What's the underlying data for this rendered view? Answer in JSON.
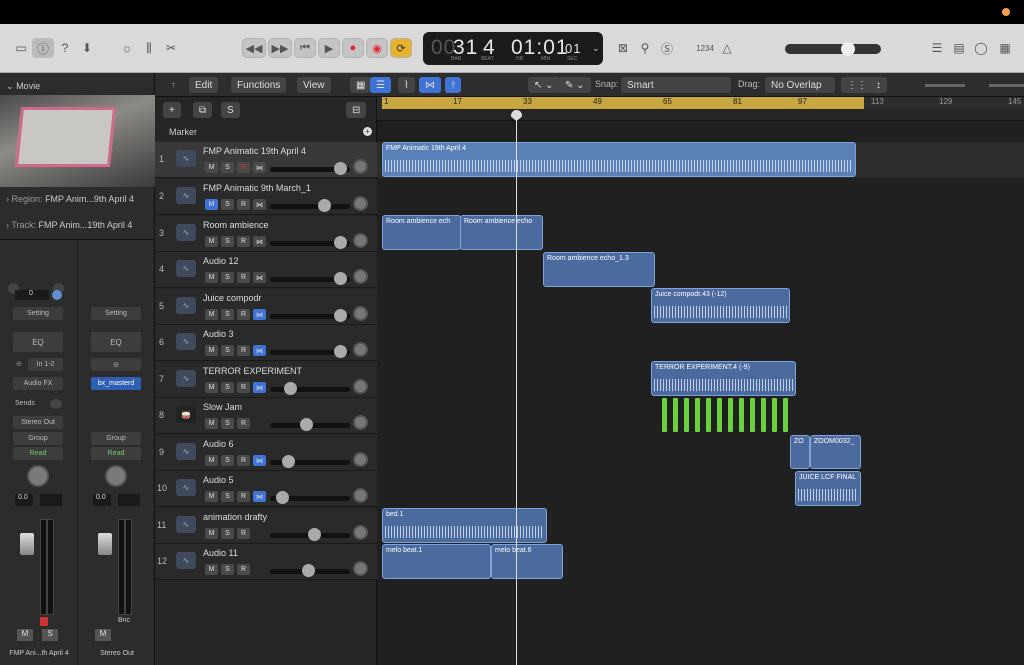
{
  "control_bar": {
    "lcd": {
      "bar": "31",
      "beat": "4",
      "bar_label": "BAR",
      "beat_label": "BEAT",
      "time": "01:01",
      "time_sub": "01",
      "hr_label": "HR",
      "min_label": "MIN",
      "sec_label": "SEC",
      "dim": "00"
    },
    "count_in": "1234"
  },
  "inspector": {
    "section": "Movie",
    "region": "Region:",
    "region_name": "FMP Anim...9th April 4",
    "track": "Track:",
    "track_name": "FMP Anim...19th April 4",
    "left": {
      "value": "0",
      "setting": "Setting",
      "eq": "EQ",
      "input": "In 1-2",
      "fx": "Audio FX",
      "sends": "Sends",
      "output": "Stereo Out",
      "group": "Group",
      "read": "Read",
      "gain": "0.0",
      "m": "M",
      "s": "S",
      "label": "FMP Ani...th April 4"
    },
    "right": {
      "setting": "Setting",
      "eq": "EQ",
      "bus": "bx_masterd",
      "group": "Group",
      "read": "Read",
      "gain": "0.0",
      "bnc": "Bnc",
      "m": "M",
      "label": "Stereo Out"
    }
  },
  "edit_bar": {
    "edit": "Edit",
    "functions": "Functions",
    "view": "View",
    "snap_label": "Snap:",
    "snap": "Smart",
    "drag_label": "Drag:",
    "drag": "No Overlap"
  },
  "track_header": {
    "s": "S",
    "marker": "Marker"
  },
  "ruler": {
    "bars": [
      "1",
      "17",
      "33",
      "49",
      "65",
      "81",
      "97",
      "113",
      "129",
      "145"
    ]
  },
  "tracks": [
    {
      "n": "1",
      "name": "FMP Animatic 19th April 4"
    },
    {
      "n": "2",
      "name": "FMP Animatic 9th March_1"
    },
    {
      "n": "3",
      "name": "Room ambience"
    },
    {
      "n": "4",
      "name": "Audio 12"
    },
    {
      "n": "5",
      "name": "Juice compodr"
    },
    {
      "n": "6",
      "name": "Audio 3"
    },
    {
      "n": "7",
      "name": "TERROR EXPERIMENT"
    },
    {
      "n": "8",
      "name": "Slow Jam"
    },
    {
      "n": "9",
      "name": "Audio 6"
    },
    {
      "n": "10",
      "name": "Audio 5"
    },
    {
      "n": "11",
      "name": "animation drafty"
    },
    {
      "n": "12",
      "name": "Audio 11"
    }
  ],
  "mini_buttons": {
    "m": "M",
    "s": "S",
    "r": "R"
  },
  "regions": {
    "r1": "FMP Animatic 19th April 4",
    "r3a": "Room ambience ech",
    "r3b": "Room ambience echo",
    "r4": "Room ambience echo_1.3",
    "r5": "Juice compodr.43 (-12)",
    "r7": "TERROR EXPERIMENT.4 (-9)",
    "r9a": "ZO",
    "r9b": "ZOOM0032_",
    "r10": "JUICE LCF FINAL",
    "r11": "bed.1",
    "r12a": "melo beat.1",
    "r12b": "melo beat.6"
  }
}
